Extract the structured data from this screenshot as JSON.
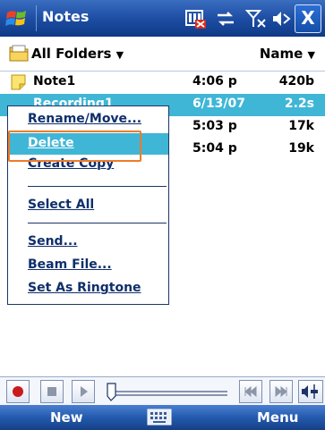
{
  "titlebar": {
    "title": "Notes",
    "close_label": "X"
  },
  "folderbar": {
    "folder": "All Folders",
    "sort": "Name"
  },
  "files": [
    {
      "name": "Note1",
      "time": "4:06 p",
      "size": "420b",
      "selected": false
    },
    {
      "name": "Recording1",
      "time": "6/13/07",
      "size": "2.2s",
      "selected": true
    },
    {
      "name": "",
      "time": "5:03 p",
      "size": "17k",
      "selected": false
    },
    {
      "name": "",
      "time": "5:04 p",
      "size": "19k",
      "selected": false
    }
  ],
  "context_menu": {
    "items": [
      "Rename/Move...",
      "Delete",
      "Create Copy",
      "Select All",
      "Send...",
      "Beam File...",
      "Set As Ringtone"
    ],
    "highlighted": "Delete"
  },
  "softkeys": {
    "left": "New",
    "right": "Menu"
  },
  "colors": {
    "accent": "#1d4ea4",
    "selection": "#3fb6d6",
    "focus": "#ef7b28"
  },
  "icons": [
    "windows-start-icon",
    "battery-icon",
    "connectivity-icon",
    "signal-icon",
    "volume-icon",
    "folder-icon",
    "note-icon",
    "record-icon",
    "stop-icon",
    "play-icon",
    "previous-icon",
    "next-icon",
    "volume-slider-icon",
    "keyboard-icon"
  ]
}
